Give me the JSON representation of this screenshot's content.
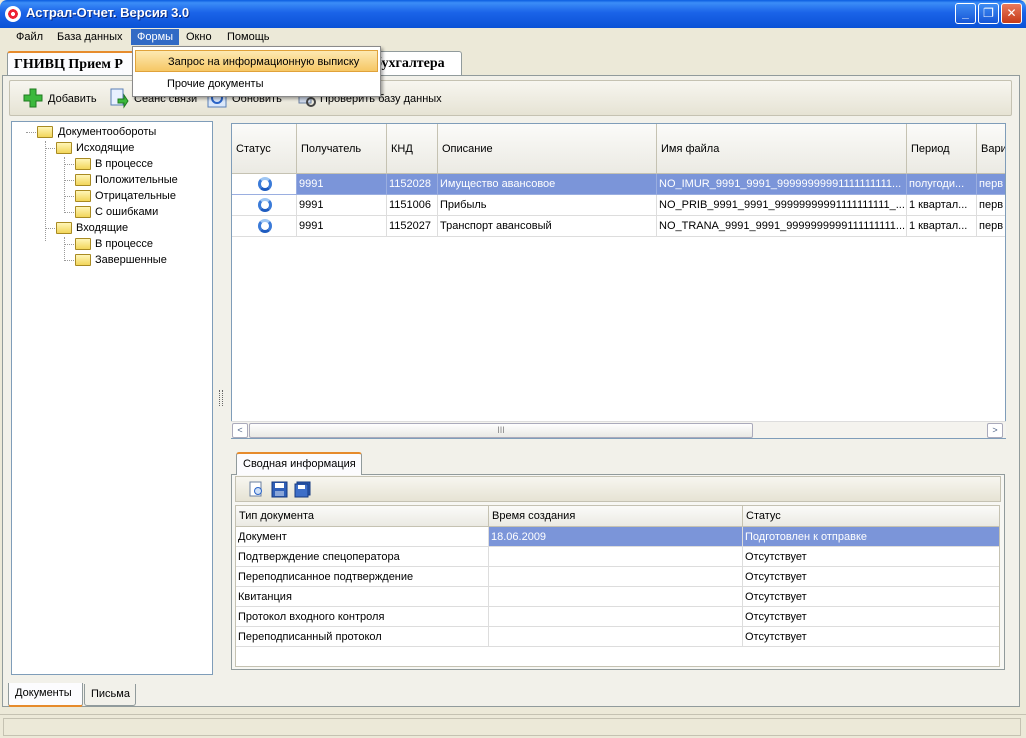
{
  "window": {
    "title": "Астрал-Отчет.  Версия 3.0",
    "minimize": "_",
    "maximize": "❐",
    "close": "✕"
  },
  "menubar": {
    "items": [
      "Файл",
      "База данных",
      "Формы",
      "Окно",
      "Помощь"
    ]
  },
  "dropdown": {
    "items": [
      "Запрос на информационную выписку",
      "Прочие документы"
    ]
  },
  "main_tabs": {
    "first": "ГНИВЦ Прием Р",
    "second": "бухгалтера"
  },
  "toolbar": {
    "add": "Добавить",
    "session": "Сеанс связи",
    "refresh": "Обновить",
    "check_db": "Проверить базу данных"
  },
  "tree": {
    "root": "Документообороты",
    "outgoing": "Исходящие",
    "out_in_progress": "В процессе",
    "out_positive": "Положительные",
    "out_negative": "Отрицательные",
    "out_errors": "С ошибками",
    "incoming": "Входящие",
    "in_in_progress": "В процессе",
    "in_completed": "Завершенные"
  },
  "grid": {
    "headers": [
      "Статус",
      "Получатель",
      "КНД",
      "Описание",
      "Имя файла",
      "Период",
      "Вари"
    ],
    "rows": [
      {
        "recipient": "9991",
        "knd": "1152028",
        "desc": "Имущество авансовое",
        "file": "NO_IMUR_9991_9991_99999999991111111111...",
        "period": "полугоди...",
        "var": "перв"
      },
      {
        "recipient": "9991",
        "knd": "1151006",
        "desc": "Прибыль",
        "file": "NO_PRIB_9991_9991_99999999991111111111_...",
        "period": "1 квартал...",
        "var": "перв"
      },
      {
        "recipient": "9991",
        "knd": "1152027",
        "desc": "Транспорт авансовый",
        "file": "NO_TRANA_9991_9991_9999999999111111111...",
        "period": "1 квартал...",
        "var": "перв"
      }
    ],
    "scroll_left": "<",
    "scroll_right": ">",
    "thumb_grip": "III"
  },
  "summary": {
    "tab": "Сводная информация",
    "headers": [
      "Тип документа",
      "Время создания",
      "Статус"
    ],
    "rows": [
      {
        "type": "Документ",
        "time": "18.06.2009",
        "status": "Подготовлен к отправке"
      },
      {
        "type": "Подтверждение спецоператора",
        "time": "",
        "status": "Отсутствует"
      },
      {
        "type": "Переподписанное подтверждение",
        "time": "",
        "status": "Отсутствует"
      },
      {
        "type": "Квитанция",
        "time": "",
        "status": "Отсутствует"
      },
      {
        "type": "Протокол входного контроля",
        "time": "",
        "status": "Отсутствует"
      },
      {
        "type": "Переподписанный протокол",
        "time": "",
        "status": "Отсутствует"
      }
    ]
  },
  "bottom_tabs": [
    "Документы",
    "Письма"
  ],
  "colors": {
    "selection": "#7b95d9",
    "menu_active": "#316ac5",
    "titlebar": "#0a52d6",
    "tab_accent": "#e68b2c"
  }
}
